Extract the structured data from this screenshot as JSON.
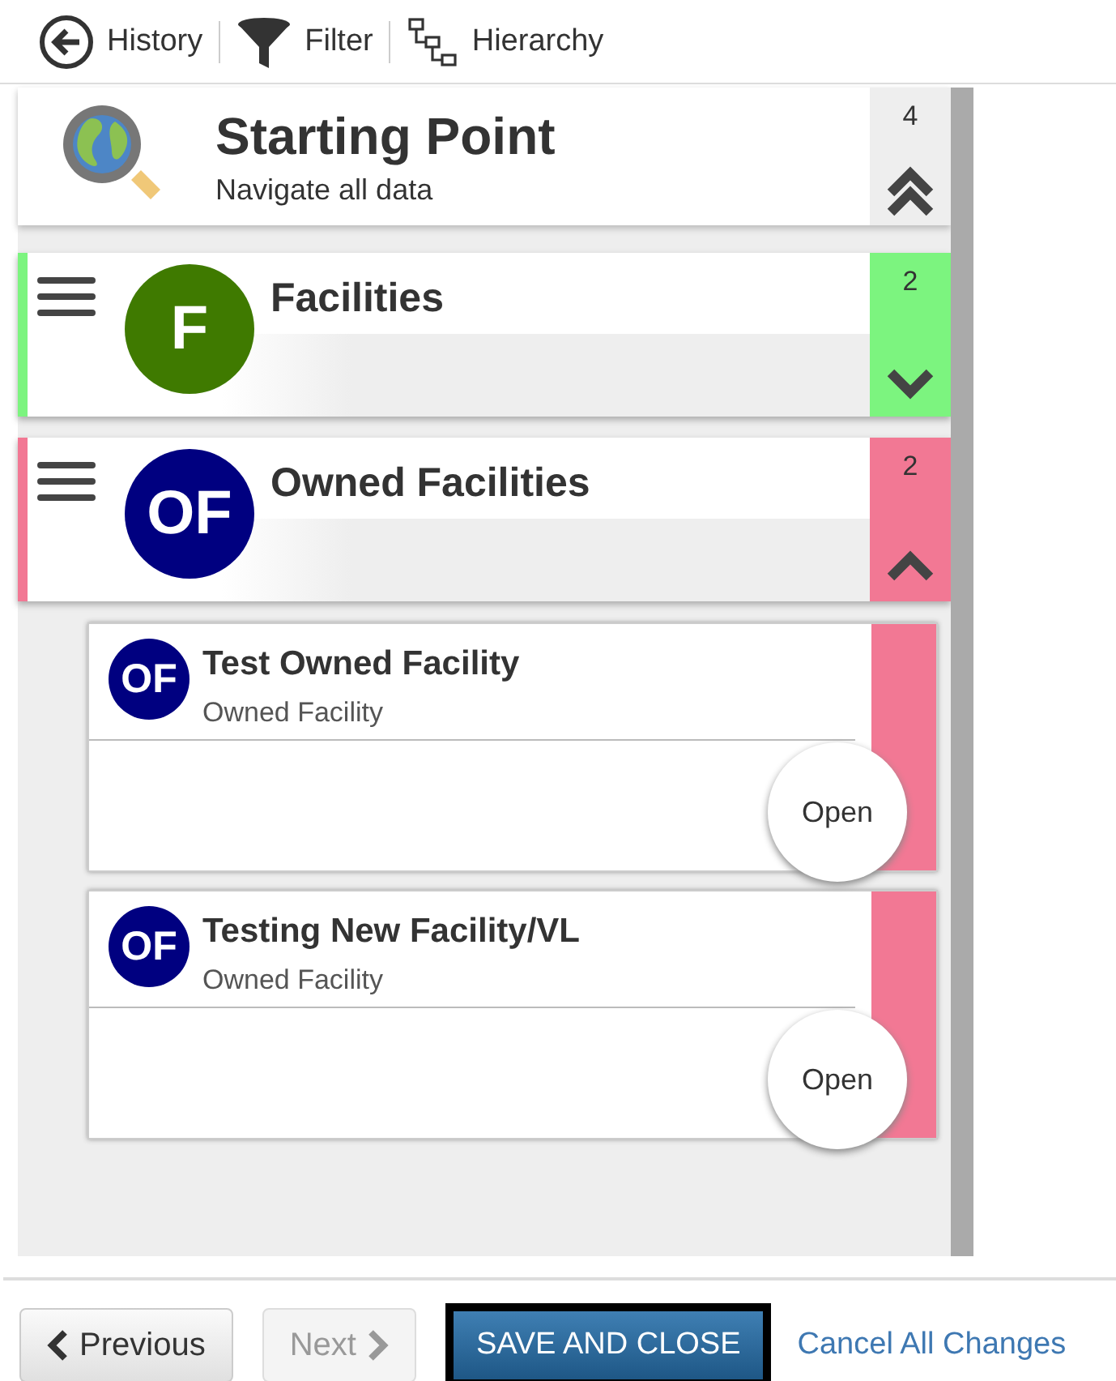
{
  "toolbar": [
    {
      "kind": "history",
      "label": "History"
    },
    {
      "kind": "filter",
      "label": "Filter"
    },
    {
      "kind": "hierarchy",
      "label": "Hierarchy"
    }
  ],
  "start": {
    "title": "Starting Point",
    "subtitle": "Navigate all data",
    "count": "4"
  },
  "groups": [
    {
      "badge": {
        "text": "F",
        "color": "#3f7a00"
      },
      "title": "Facilities",
      "count": "2",
      "color": "#7cf47f",
      "expanded": false
    },
    {
      "badge": {
        "text": "OF",
        "color": "#000080"
      },
      "title": "Owned Facilities",
      "count": "2",
      "color": "#f27894",
      "expanded": true,
      "children": [
        {
          "badge": "OF",
          "title": "Test Owned Facility",
          "subtitle": "Owned Facility",
          "action": "Open"
        },
        {
          "badge": "OF",
          "title": "Testing New Facility/VL",
          "subtitle": "Owned Facility",
          "action": "Open"
        }
      ]
    }
  ],
  "footer": {
    "previous": {
      "label": "Previous",
      "disabled": false
    },
    "next": {
      "label": "Next",
      "disabled": true
    },
    "save": "SAVE AND CLOSE",
    "cancel": "Cancel All Changes"
  }
}
